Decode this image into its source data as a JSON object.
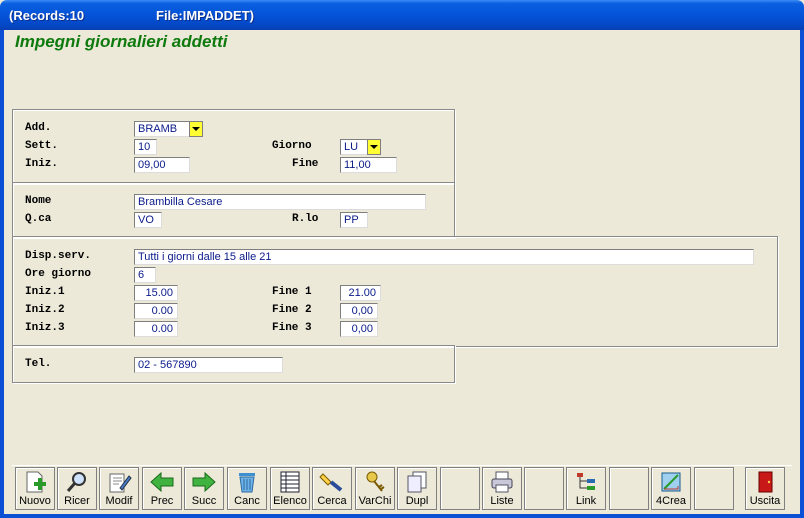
{
  "window": {
    "records": "(Records:10",
    "file": "File:IMPADDET)"
  },
  "heading": "Impegni giornalieri addetti",
  "group1": {
    "add_label": "Add.",
    "add_value": "BRAMB",
    "sett_label": "Sett.",
    "sett_value": "10",
    "giorno_label": "Giorno",
    "giorno_value": "LU",
    "iniz_label": "Iniz.",
    "iniz_value": "09,00",
    "fine_label": "Fine",
    "fine_value": "11,00"
  },
  "group2": {
    "nome_label": "Nome",
    "nome_value": "Brambilla Cesare",
    "qca_label": "Q.ca",
    "qca_value": "VO",
    "rlo_label": "R.lo",
    "rlo_value": "PP"
  },
  "group3": {
    "disp_label": "Disp.serv.",
    "disp_value": "Tutti i giorni dalle 15 alle 21",
    "ore_label": "Ore giorno",
    "ore_value": "6",
    "iniz1_label": "Iniz.1",
    "iniz1_value": "15.00",
    "iniz2_label": "Iniz.2",
    "iniz2_value": "0.00",
    "iniz3_label": "Iniz.3",
    "iniz3_value": "0.00",
    "fine1_label": "Fine 1",
    "fine1_value": "21.00",
    "fine2_label": "Fine 2",
    "fine2_value": "0,00",
    "fine3_label": "Fine 3",
    "fine3_value": "0,00"
  },
  "group4": {
    "tel_label": "Tel.",
    "tel_value": "02 - 567890"
  },
  "toolbar": [
    {
      "label": "Nuovo",
      "icon": "new-document-icon"
    },
    {
      "label": "Ricer",
      "icon": "magnifier-icon"
    },
    {
      "label": "Modif",
      "icon": "edit-document-icon"
    },
    {
      "label": "Prec",
      "icon": "arrow-left-icon"
    },
    {
      "label": "Succ",
      "icon": "arrow-right-icon"
    },
    {
      "label": "Canc",
      "icon": "trash-icon"
    },
    {
      "label": "Elenco",
      "icon": "list-icon"
    },
    {
      "label": "Cerca",
      "icon": "flashlight-icon"
    },
    {
      "label": "VarChi",
      "icon": "keys-icon"
    },
    {
      "label": "Dupl",
      "icon": "duplicate-icon"
    },
    {
      "label": "",
      "icon": ""
    },
    {
      "label": "Liste",
      "icon": "printer-icon"
    },
    {
      "label": "",
      "icon": ""
    },
    {
      "label": "Link",
      "icon": "link-tree-icon"
    },
    {
      "label": "",
      "icon": ""
    },
    {
      "label": "4Crea",
      "icon": "design-icon"
    },
    {
      "label": "",
      "icon": ""
    },
    {
      "label": "Uscita",
      "icon": "exit-door-icon"
    }
  ],
  "colors": {
    "titlebar": "#0553d8",
    "heading": "#0e7a0e",
    "field_text": "#0a1a8a",
    "dropdown": "#ffff33"
  }
}
